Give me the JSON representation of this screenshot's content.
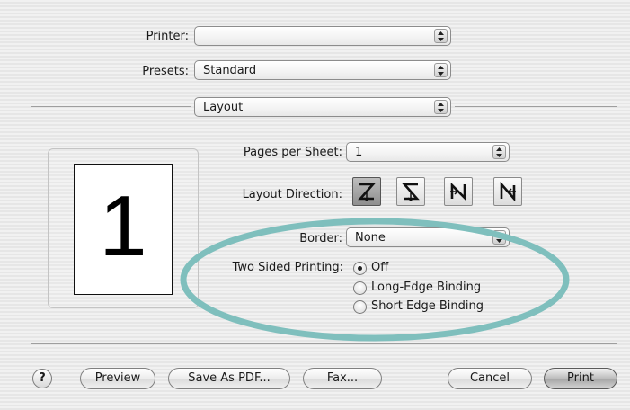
{
  "printer": {
    "label": "Printer:",
    "value": ""
  },
  "presets": {
    "label": "Presets:",
    "value": "Standard"
  },
  "section": {
    "value": "Layout"
  },
  "preview": {
    "page_number": "1"
  },
  "layout": {
    "pages_per_sheet_label": "Pages per Sheet:",
    "pages_per_sheet_value": "1",
    "direction_label": "Layout Direction:",
    "directions": [
      "z-right-down",
      "s-left-down",
      "n-down-right",
      "n-down-left"
    ],
    "selected_direction": "z-right-down",
    "border_label": "Border:",
    "border_value": "None"
  },
  "two_sided": {
    "label": "Two Sided Printing:",
    "options": [
      {
        "label": "Off",
        "checked": true
      },
      {
        "label": "Long-Edge Binding",
        "checked": false
      },
      {
        "label": "Short Edge Binding",
        "checked": false
      }
    ]
  },
  "buttons": {
    "help": "?",
    "preview": "Preview",
    "save_pdf": "Save As PDF...",
    "fax": "Fax...",
    "cancel": "Cancel",
    "print": "Print"
  },
  "icons": {
    "popup_arrows": "updown-arrows-icon",
    "radio": "radio-button"
  },
  "colors": {
    "highlight_ellipse": "#7fbfbd"
  }
}
